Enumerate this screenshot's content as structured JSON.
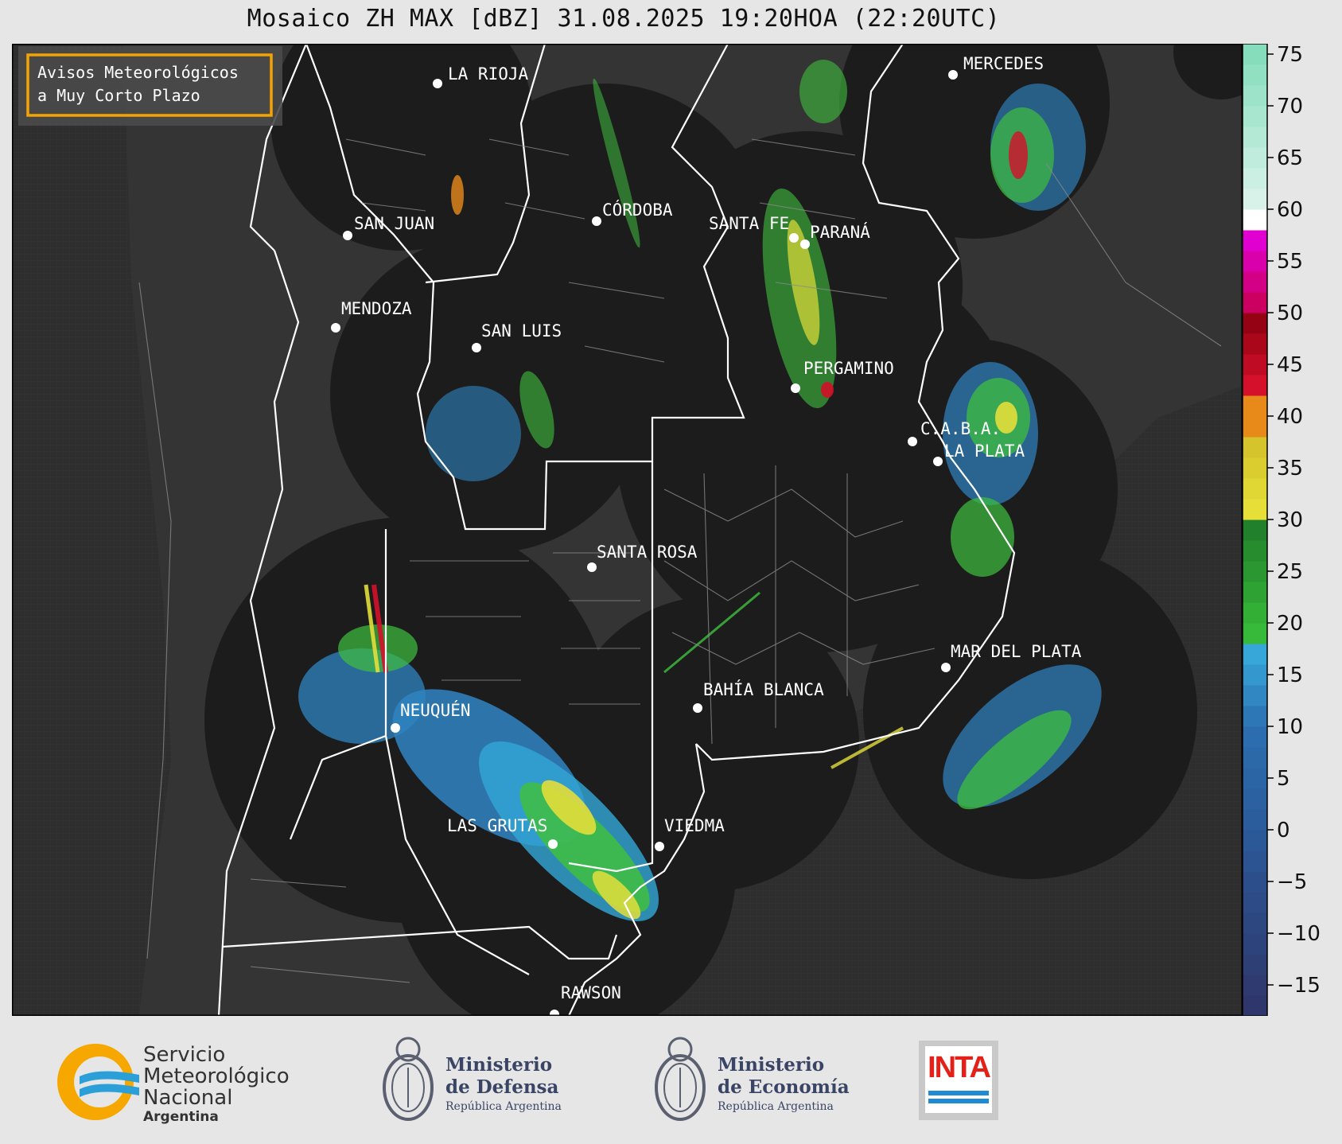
{
  "title": "Mosaico ZH MAX [dBZ] 31.08.2025 19:20HOA (22:20UTC)",
  "notice": {
    "line1": "Avisos Meteorológicos",
    "line2": "a Muy Corto Plazo",
    "border_color": "#f5a300"
  },
  "cities": [
    {
      "name": "LA RIOJA"
    },
    {
      "name": "MERCEDES"
    },
    {
      "name": "SAN JUAN"
    },
    {
      "name": "CÓRDOBA"
    },
    {
      "name": "SANTA FE"
    },
    {
      "name": "PARANÁ"
    },
    {
      "name": "MENDOZA"
    },
    {
      "name": "SAN LUIS"
    },
    {
      "name": "PERGAMINO"
    },
    {
      "name": "C.A.B.A."
    },
    {
      "name": "LA PLATA"
    },
    {
      "name": "SANTA ROSA"
    },
    {
      "name": "MAR DEL PLATA"
    },
    {
      "name": "BAHÍA BLANCA"
    },
    {
      "name": "NEUQUÉN"
    },
    {
      "name": "LAS GRUTAS"
    },
    {
      "name": "VIEDMA"
    },
    {
      "name": "RAWSON"
    }
  ],
  "colorbar": {
    "unit": "dBZ",
    "ticks": [
      "75",
      "70",
      "65",
      "60",
      "55",
      "50",
      "45",
      "40",
      "35",
      "30",
      "25",
      "20",
      "15",
      "10",
      "5",
      "0",
      "−5",
      "−10",
      "−15"
    ],
    "range": [
      -18,
      76
    ],
    "colors": {
      "clear": "#2f3468",
      "weak": "#2b6fb0",
      "light": "#37a7d9",
      "green": "#39c03a",
      "yellow": "#e8e33a",
      "orange": "#e88a1a",
      "red": "#d4102a",
      "magenta": "#e000d0",
      "white": "#ffffff",
      "mint": "#7fdcb8"
    }
  },
  "footer": {
    "smn": {
      "line1": "Servicio",
      "line2": "Meteorológico",
      "line3": "Nacional",
      "line4": "Argentina"
    },
    "defensa": {
      "line1": "Ministerio",
      "line2": "de Defensa",
      "line3": "República Argentina"
    },
    "economia": {
      "line1": "Ministerio",
      "line2": "de Economía",
      "line3": "República Argentina"
    },
    "inta": {
      "label": "INTA"
    }
  }
}
